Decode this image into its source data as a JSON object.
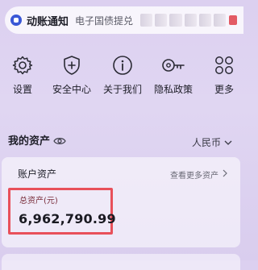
{
  "notification": {
    "title": "动账通知",
    "text": "电子国债提兑"
  },
  "menu": {
    "items": [
      {
        "label": "设置",
        "icon": "gear-icon"
      },
      {
        "label": "安全中心",
        "icon": "shield-icon"
      },
      {
        "label": "关于我们",
        "icon": "info-icon"
      },
      {
        "label": "隐私政策",
        "icon": "key-icon"
      },
      {
        "label": "更多",
        "icon": "grid-icon"
      }
    ]
  },
  "assets": {
    "title": "我的资产",
    "currency": "人民币",
    "card": {
      "title": "账户资产",
      "link": "查看更多资产",
      "total_label": "总资产(元)",
      "total_value": "6,962,790.99"
    }
  },
  "colors": {
    "highlight_border": "#e8505a",
    "notify_icon": "#3a57d6"
  }
}
